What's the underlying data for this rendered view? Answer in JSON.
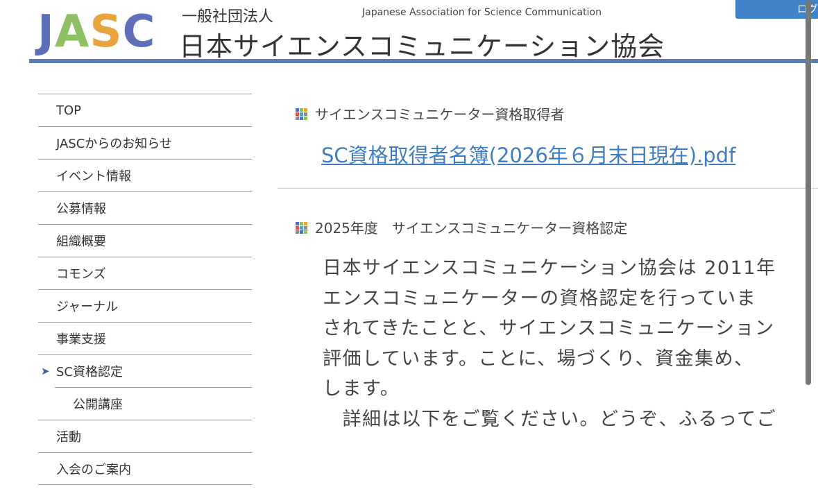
{
  "header": {
    "logo_letters": [
      {
        "ch": "J",
        "color": "#5a6fb5"
      },
      {
        "ch": "A",
        "color": "#8cc063"
      },
      {
        "ch": "S",
        "color": "#e7a33c"
      },
      {
        "ch": "C",
        "color": "#5f6fb8"
      }
    ],
    "org_type": "一般社団法人",
    "org_name": "日本サイエンスコミュニケーション協会",
    "org_name_en": "Japanese Association for Science Communication",
    "login_label": "ログイ"
  },
  "sidebar": {
    "items": [
      {
        "label": "TOP"
      },
      {
        "label": "JASCからのお知らせ"
      },
      {
        "label": "イベント情報"
      },
      {
        "label": "公募情報"
      },
      {
        "label": "組織概要"
      },
      {
        "label": "コモンズ"
      },
      {
        "label": "ジャーナル"
      },
      {
        "label": "事業支援"
      },
      {
        "label": "SC資格認定",
        "current": true,
        "marker": "➤"
      },
      {
        "label": "公開講座",
        "sub": true
      },
      {
        "label": "活動"
      },
      {
        "label": "入会のご案内"
      }
    ]
  },
  "main": {
    "section1": {
      "title": "サイエンスコミュニケーター資格取得者",
      "link": "SC資格取得者名簿(2026年６月末日現在).pdf"
    },
    "section2": {
      "title": "2025年度　サイエンスコミュニケーター資格認定",
      "lines": [
        "日本サイエンスコミュニケーション協会は 2011年",
        "エンスコミュニケーターの資格認定を行っていま",
        "されてきたことと、サイエンスコミュニケーション",
        "評価しています。ことに、場づくり、資金集め、",
        "します。",
        "　詳細は以下をご覧ください。どうぞ、ふるってご"
      ]
    }
  }
}
